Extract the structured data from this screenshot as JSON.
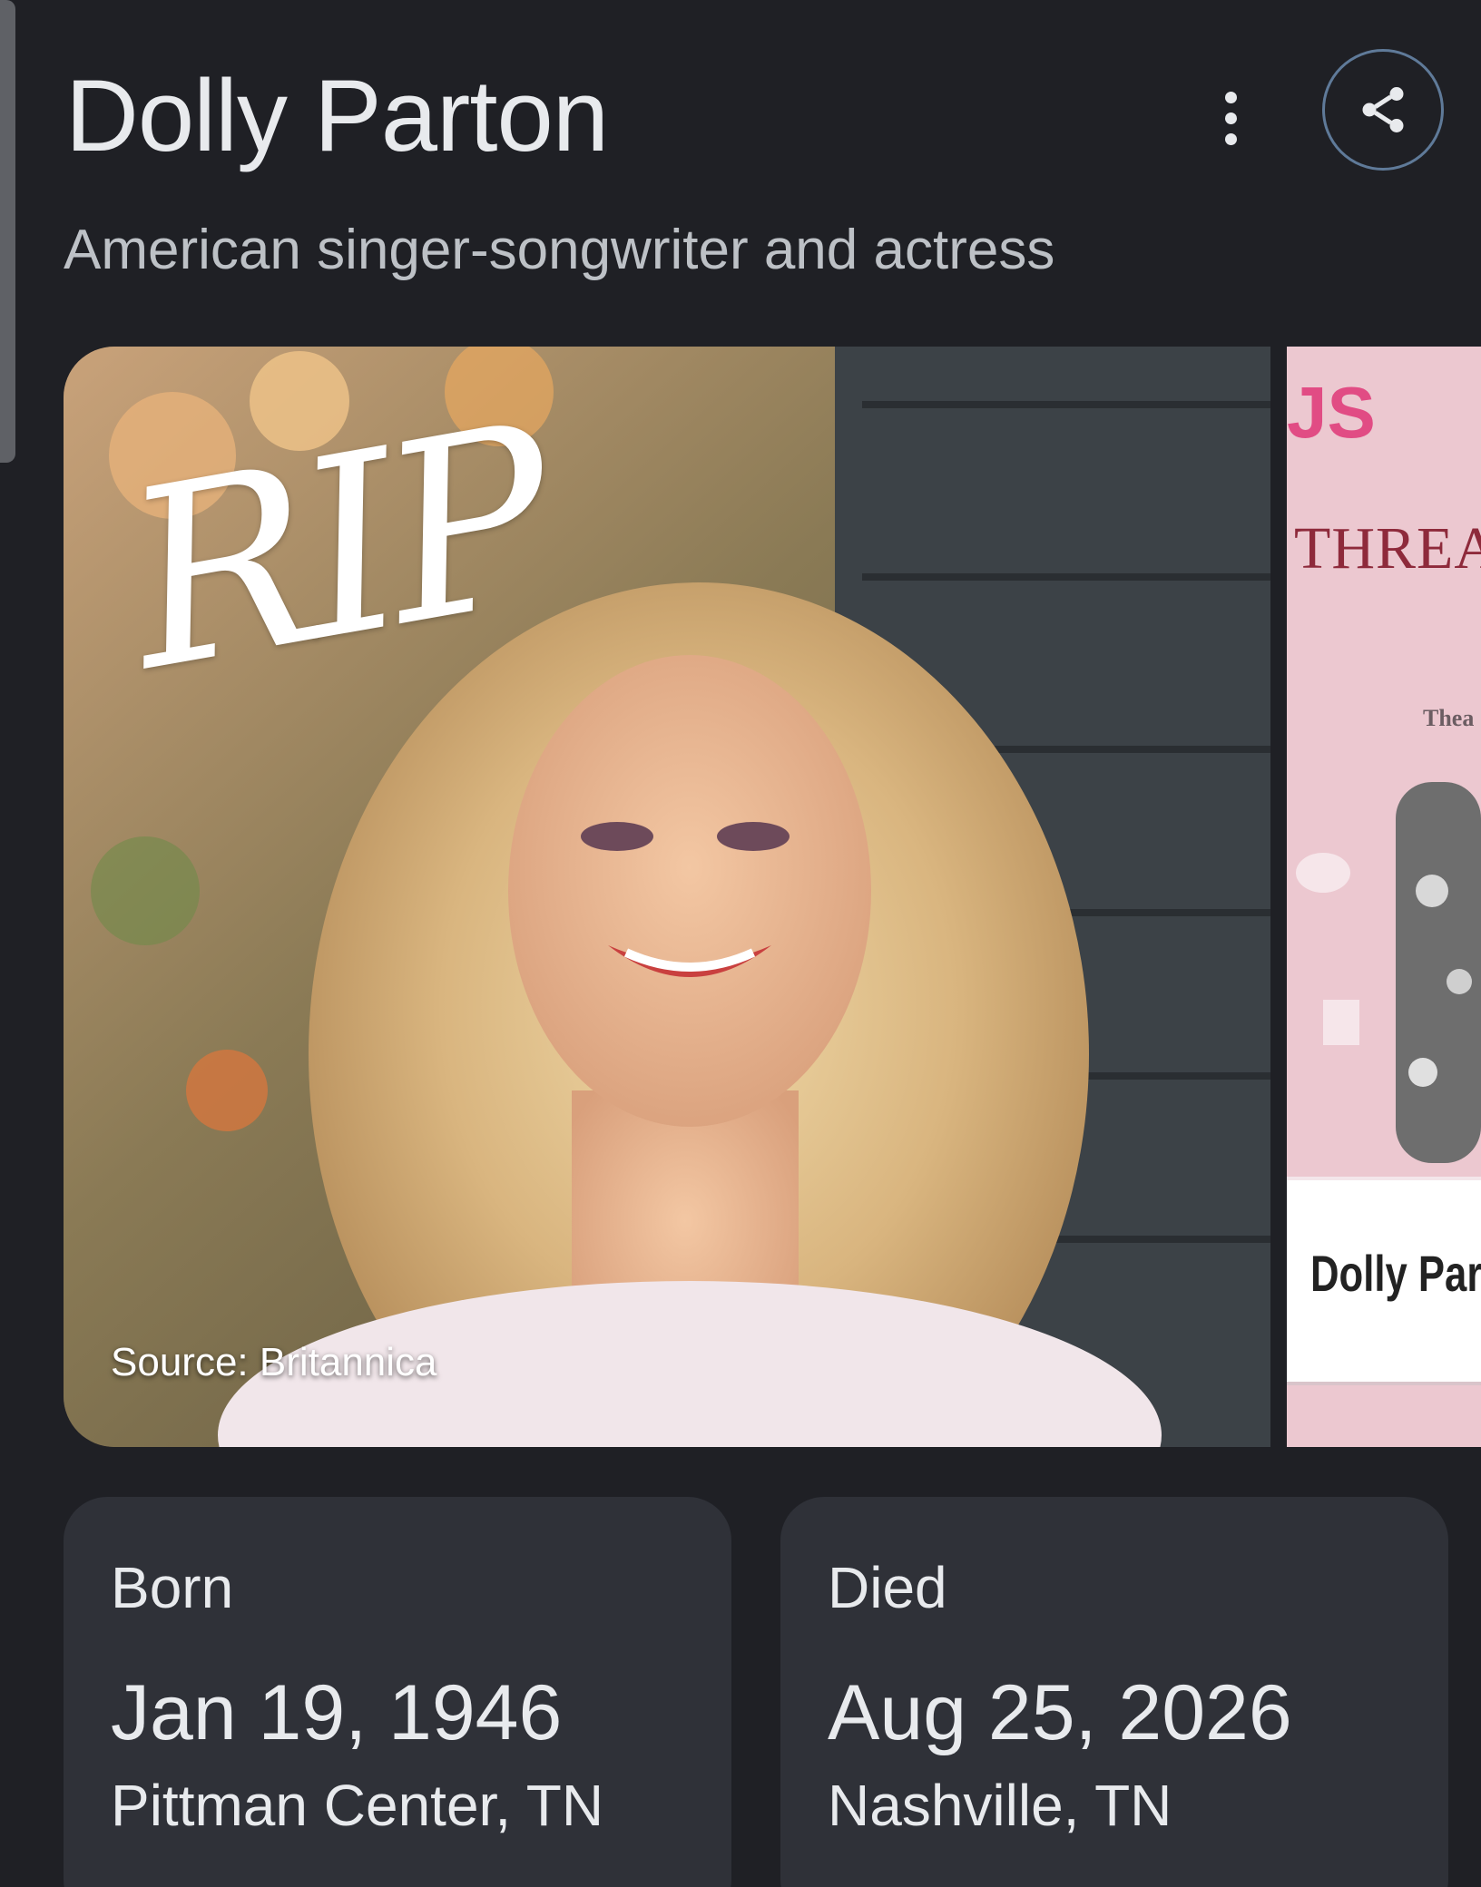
{
  "header": {
    "title": "Dolly Parton",
    "subtitle": "American singer-songwriter and actress",
    "more_icon": "more-vert-icon",
    "share_icon": "share-icon"
  },
  "gallery": {
    "main_image": {
      "overlay_text": "RIP",
      "source": "Source: Britannica"
    },
    "side_image": {
      "caption": "Dolly Parto",
      "sign_text_1": "THREAD",
      "sign_text_2": "Thea"
    }
  },
  "facts": {
    "born": {
      "label": "Born",
      "date": "Jan 19, 1946",
      "place": "Pittman Center, TN"
    },
    "died": {
      "label": "Died",
      "date": "Aug 25, 2026",
      "place": "Nashville, TN"
    }
  },
  "colors": {
    "background": "#1f2025",
    "card": "#2f3138",
    "text_primary": "#e8eaed",
    "text_secondary": "#bdc1c6",
    "share_border": "#5f7a99"
  }
}
